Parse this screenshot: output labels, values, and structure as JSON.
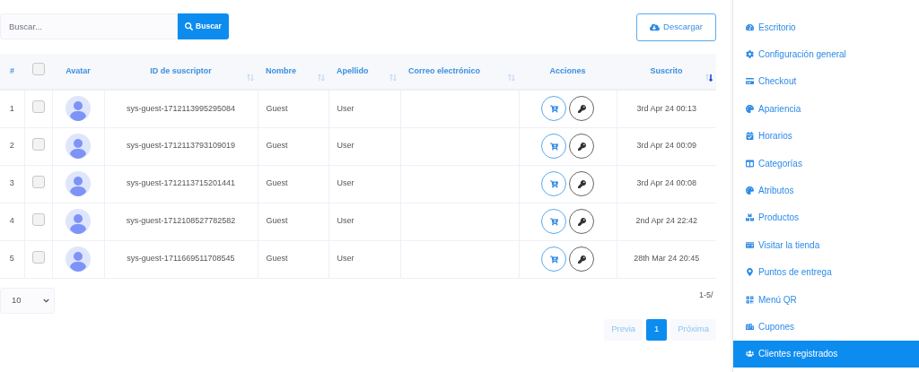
{
  "search": {
    "placeholder": "Buscar...",
    "button": "Buscar"
  },
  "download_button": "Descargar",
  "table": {
    "select_all_checked": false,
    "columns": [
      {
        "label": "#",
        "sortable": false
      },
      {
        "label": "Avatar",
        "sortable": false
      },
      {
        "label": "ID de suscriptor",
        "sortable": true,
        "sorted": false
      },
      {
        "label": "Nombre",
        "sortable": true,
        "sorted": false
      },
      {
        "label": "Apellido",
        "sortable": true,
        "sorted": false
      },
      {
        "label": "Correo electrónico",
        "sortable": true,
        "sorted": false
      },
      {
        "label": "Acciones",
        "sortable": false
      },
      {
        "label": "Suscrito",
        "sortable": true,
        "sorted": true
      }
    ],
    "rows": [
      {
        "index": "1",
        "checked": false,
        "id": "sys-guest-1712113995295084",
        "first_name": "Guest",
        "last_name": "User",
        "date": "3rd Apr 24 00:13"
      },
      {
        "index": "2",
        "checked": false,
        "id": "sys-guest-1712113793109019",
        "first_name": "Guest",
        "last_name": "User",
        "date": "3rd Apr 24 00:09"
      },
      {
        "index": "3",
        "checked": false,
        "id": "sys-guest-1712113715201441",
        "first_name": "Guest",
        "last_name": "User",
        "date": "3rd Apr 24 00:08"
      },
      {
        "index": "4",
        "checked": false,
        "id": "sys-guest-1712108527782582",
        "first_name": "Guest",
        "last_name": "User",
        "date": "2nd Apr 24 22:42"
      },
      {
        "index": "5",
        "checked": false,
        "id": "sys-guest-1711669511708545",
        "first_name": "Guest",
        "last_name": "User",
        "date": "28th Mar 24 20:45"
      }
    ]
  },
  "page_size": "10",
  "range": "1-5/",
  "pagination": [
    {
      "label": "Previa",
      "kind": "nav",
      "selected": false
    },
    {
      "label": "1",
      "kind": "page",
      "selected": true
    },
    {
      "label": "Próxima",
      "kind": "nav",
      "selected": false
    }
  ],
  "sidebar": {
    "items": [
      {
        "label": "Escritorio",
        "selected": false
      },
      {
        "label": "Configuración general",
        "selected": false
      },
      {
        "label": "Checkout",
        "selected": false
      },
      {
        "label": "Apariencia",
        "selected": false
      },
      {
        "label": "Horarios",
        "selected": false
      },
      {
        "label": "Categorías",
        "selected": false
      },
      {
        "label": "Atributos",
        "selected": false
      },
      {
        "label": "Productos",
        "selected": false
      },
      {
        "label": "Visitar la tienda",
        "selected": false
      },
      {
        "label": "Puntos de entrega",
        "selected": false
      },
      {
        "label": "Menú QR",
        "selected": false
      },
      {
        "label": "Cupones",
        "selected": false
      },
      {
        "label": "Clientes registrados",
        "selected": true
      }
    ]
  }
}
